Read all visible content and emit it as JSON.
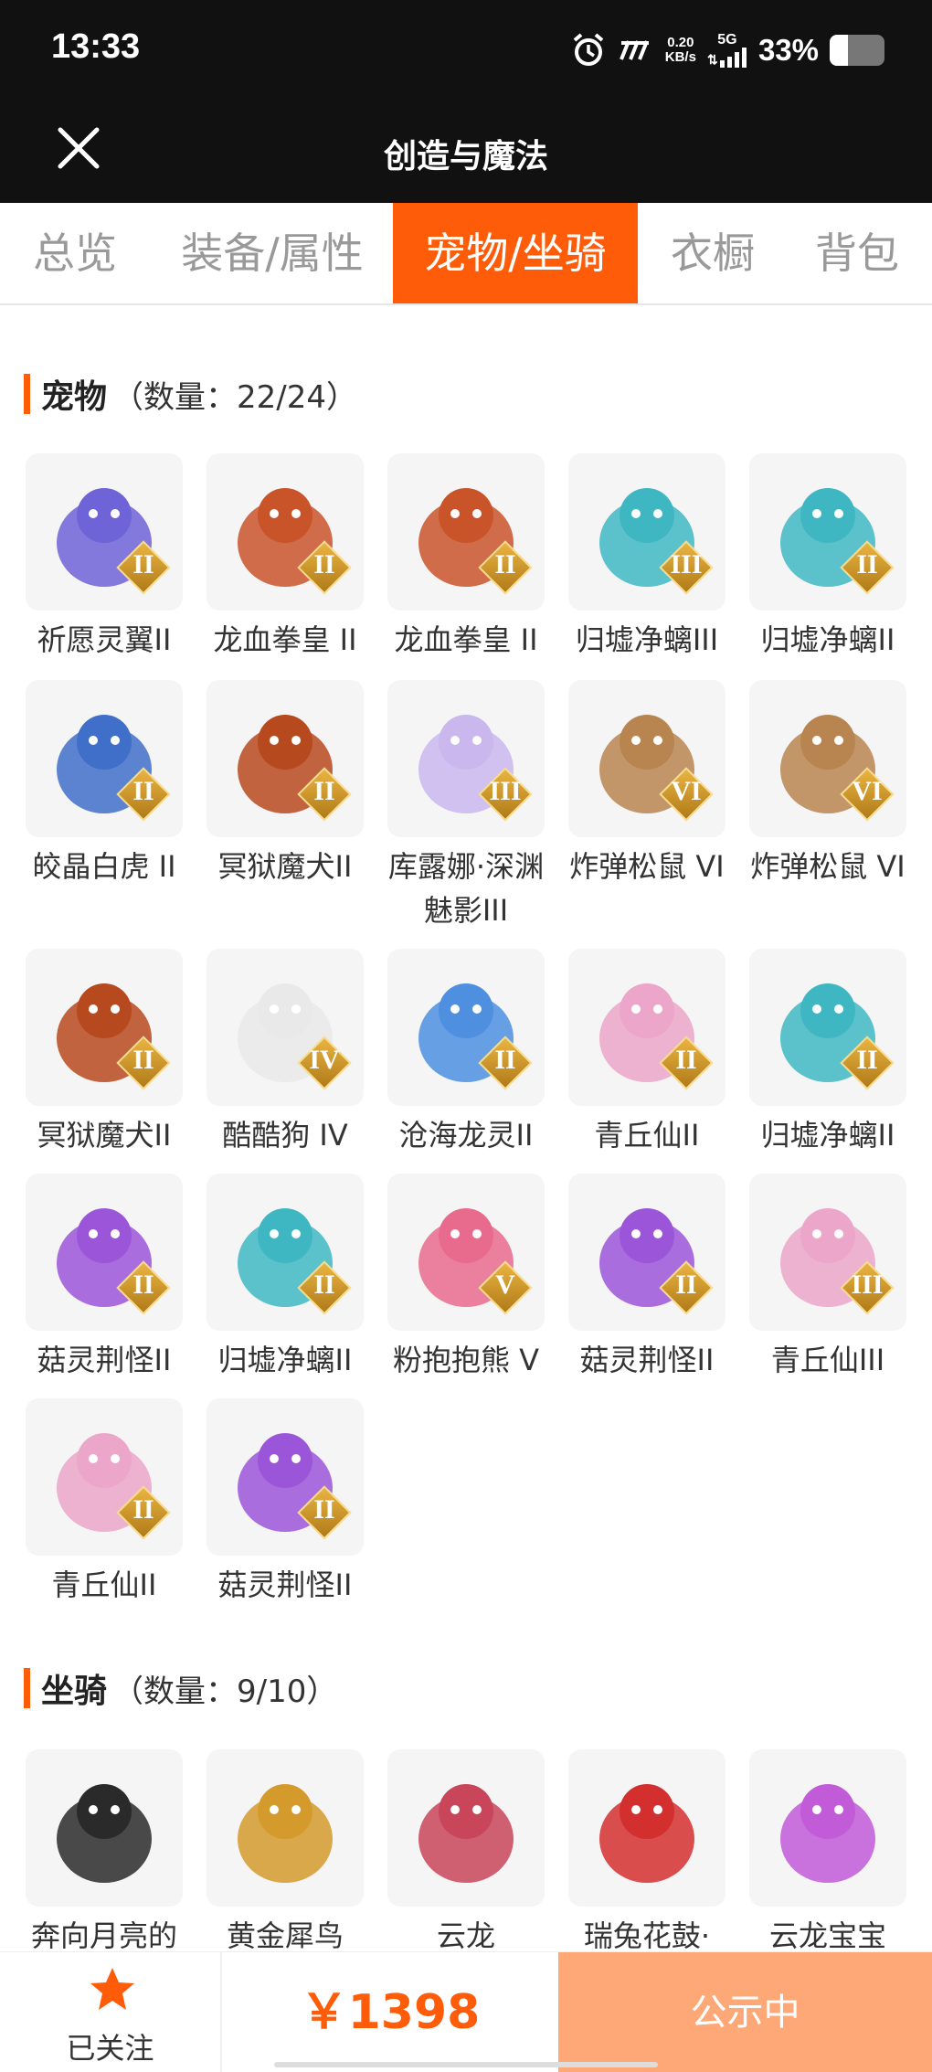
{
  "status_bar": {
    "time": "13:33",
    "net_speed_value": "0.20",
    "net_speed_unit": "KB/s",
    "network": "5G",
    "battery_text": "33%",
    "battery_level": 0.33
  },
  "header": {
    "title": "创造与魔法"
  },
  "tabs": [
    {
      "label": "总览"
    },
    {
      "label": "装备/属性"
    },
    {
      "label": "宠物/坐骑"
    },
    {
      "label": "衣橱"
    },
    {
      "label": "背包"
    }
  ],
  "pets": {
    "title": "宠物",
    "count": "（数量：22/24）",
    "items": [
      {
        "name": "祈愿灵翼II",
        "rank": "II",
        "color": "#6f63d8"
      },
      {
        "name": "龙血拳皇 II",
        "rank": "II",
        "color": "#c9542a"
      },
      {
        "name": "龙血拳皇 II",
        "rank": "II",
        "color": "#c9542a"
      },
      {
        "name": "归墟净螭III",
        "rank": "III",
        "color": "#3fb7c2"
      },
      {
        "name": "归墟净螭II",
        "rank": "II",
        "color": "#3fb7c2"
      },
      {
        "name": "皎晶白虎 II",
        "rank": "II",
        "color": "#3f6fc8"
      },
      {
        "name": "冥狱魔犬II",
        "rank": "II",
        "color": "#b7491f"
      },
      {
        "name": "库露娜·深渊魅影III",
        "rank": "III",
        "color": "#c9b7ee"
      },
      {
        "name": "炸弹松鼠 VI",
        "rank": "VI",
        "color": "#b88550"
      },
      {
        "name": "炸弹松鼠 VI",
        "rank": "VI",
        "color": "#b88550"
      },
      {
        "name": "冥狱魔犬II",
        "rank": "II",
        "color": "#b7491f"
      },
      {
        "name": "酷酷狗 IV",
        "rank": "IV",
        "color": "#e9e9e9"
      },
      {
        "name": "沧海龙灵II",
        "rank": "II",
        "color": "#4e8fe0"
      },
      {
        "name": "青丘仙II",
        "rank": "II",
        "color": "#eba6c9"
      },
      {
        "name": "归墟净螭II",
        "rank": "II",
        "color": "#3fb7c2"
      },
      {
        "name": "菇灵荆怪II",
        "rank": "II",
        "color": "#9b55d8"
      },
      {
        "name": "归墟净螭II",
        "rank": "II",
        "color": "#3fb7c2"
      },
      {
        "name": "粉抱抱熊 V",
        "rank": "V",
        "color": "#e86b8d"
      },
      {
        "name": "菇灵荆怪II",
        "rank": "II",
        "color": "#9b55d8"
      },
      {
        "name": "青丘仙III",
        "rank": "III",
        "color": "#eba6c9"
      },
      {
        "name": "青丘仙II",
        "rank": "II",
        "color": "#eba6c9"
      },
      {
        "name": "菇灵荆怪II",
        "rank": "II",
        "color": "#9b55d8"
      }
    ]
  },
  "mounts": {
    "title": "坐骑",
    "count": "（数量：9/10）",
    "items": [
      {
        "name": "奔向月亮的",
        "color": "#2a2a2a"
      },
      {
        "name": "黄金犀鸟",
        "color": "#d49a2b"
      },
      {
        "name": "云龙",
        "color": "#c8455a"
      },
      {
        "name": "瑞兔花鼓·",
        "color": "#d32f2f"
      },
      {
        "name": "云龙宝宝",
        "color": "#c15bd8"
      }
    ]
  },
  "bottom": {
    "follow_label": "已关注",
    "price": "￥1398",
    "status_label": "公示中"
  },
  "colors": {
    "accent": "#ff5c0a",
    "status_button": "#ffa877"
  }
}
